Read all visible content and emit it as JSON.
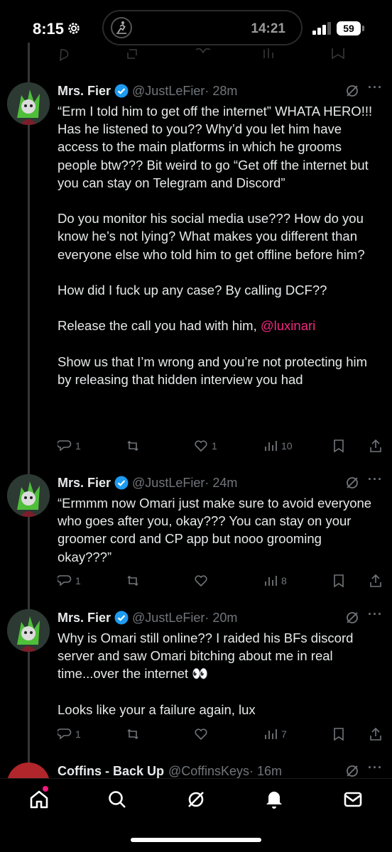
{
  "status_bar": {
    "time": "8:15",
    "island_time": "14:21",
    "battery": "59",
    "icons": [
      "gear-icon",
      "fitness-icon",
      "signal-icon",
      "battery-icon"
    ]
  },
  "tweets": [
    {
      "name": "Mrs. Fier",
      "handle": "@JustLeFier",
      "time": "· 28m",
      "paragraphs": [
        "“Erm I told him to get off the internet” WHATA HERO!!! Has he listened to you?? Why’d you let him have access to the main platforms in which he grooms people btw??? Bit weird to go “Get off the internet but you can stay on Telegram and Discord”",
        "Do you monitor his social media use??? How do you know he’s not lying? What makes you different than everyone else who told him to get offline before him?",
        "How did I fuck up any case? By calling DCF??"
      ],
      "p4_text": "Release the call you had with him, ",
      "p4_mention": "@luxinari",
      "p5": "Show us that I’m wrong and you’re not protecting him by releasing that hidden interview you had",
      "replies": "1",
      "likes": "1",
      "views": "10"
    },
    {
      "name": "Mrs. Fier",
      "handle": "@JustLeFier",
      "time": "· 24m",
      "paragraphs": [
        "“Ermmm now Omari just make sure to avoid everyone who goes after you, okay??? You can stay on your groomer cord and CP app but nooo grooming okay???”"
      ],
      "replies": "1",
      "views": "8"
    },
    {
      "name": "Mrs. Fier",
      "handle": "@JustLeFier",
      "time": "· 20m",
      "paragraphs": [
        "Why is Omari still online?? I raided his BFs discord server and saw Omari bitching about me in real time...over the internet 👀",
        "Looks like your a failure again, lux"
      ],
      "replies": "1",
      "views": "7"
    },
    {
      "name": "Coffins - Back Up",
      "handle": "@CoffinsKeys",
      "time": "· 16m"
    }
  ],
  "nav": {
    "items": [
      "home-icon",
      "search-icon",
      "grok-icon",
      "notifications-icon",
      "messages-icon"
    ]
  },
  "colors": {
    "background": "#000000",
    "text": "#e7e9ea",
    "muted": "#71767b",
    "mention": "#f0287f",
    "verified": "#1d9bf0",
    "notification_dot": "#f91880"
  }
}
